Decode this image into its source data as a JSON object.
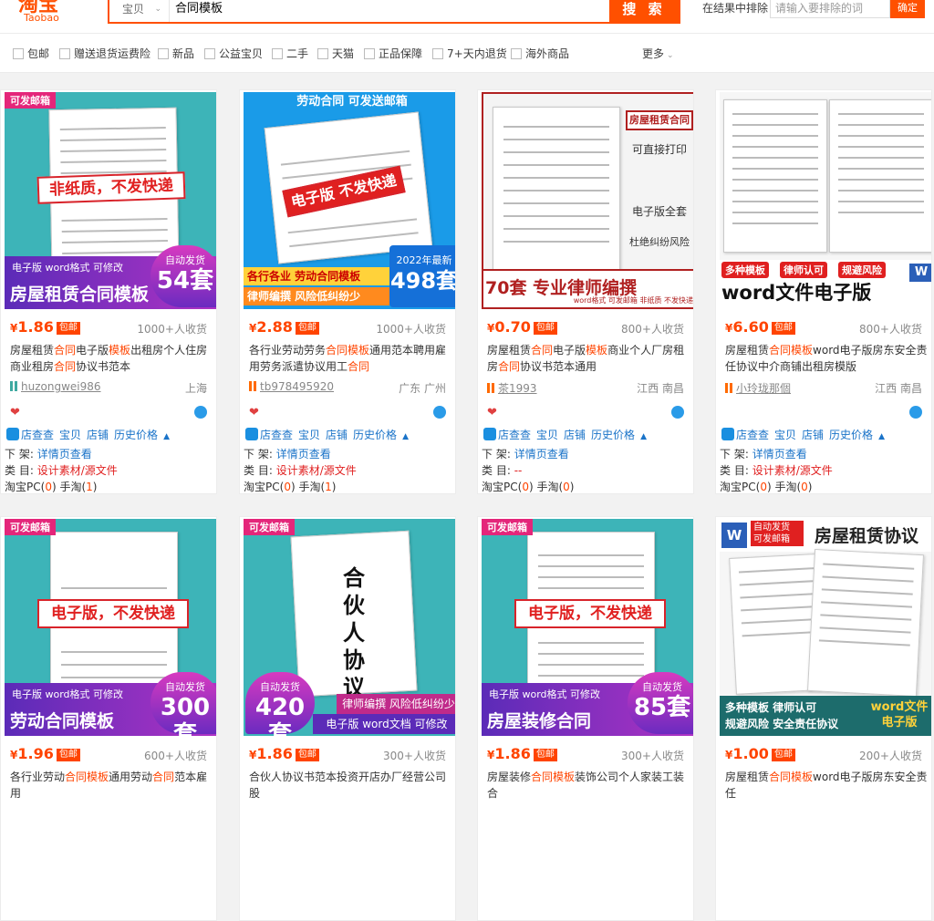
{
  "header": {
    "logo_cn": "淘宝",
    "logo_en": "Taobao",
    "search_category": "宝贝",
    "search_query": "合同模板",
    "search_button": "搜 索",
    "exclude_label": "在结果中排除",
    "exclude_placeholder": "请输入要排除的词",
    "exclude_button": "确定"
  },
  "filters": [
    "包邮",
    "赠送退货运费险",
    "新品",
    "公益宝贝",
    "二手",
    "天猫",
    "正品保障",
    "7+天内退货",
    "海外商品"
  ],
  "more_label": "更多",
  "products": [
    {
      "tag": "可发邮箱",
      "img_band": "非纸质，不发快递",
      "img_small": "电子版 word格式 可修改",
      "img_big": "房屋租赁合同模板",
      "img_badge_small": "自动发货",
      "img_badge_num": "54套",
      "price": "1.86",
      "post": "包邮",
      "sold": "1000+人收货",
      "title": "房屋租赁合同电子版模板出租房个人住房商业租房合同协议书范本",
      "shop": "huzongwei986",
      "loc": "上海",
      "tools": [
        "店查查",
        "宝贝",
        "店铺",
        "历史价格"
      ],
      "xiajia": "详情页查看",
      "cat": "设计素材/源文件",
      "pc": "0",
      "sj": "1"
    },
    {
      "tag": "劳动合同 可发送邮箱",
      "img_band": "电子版 不发快递",
      "img_small": "各行各业 劳动合同模板",
      "img_big": "律师编撰 风险低纠纷少",
      "img_badge_small": "2022年最新",
      "img_badge_num": "498套",
      "price": "2.88",
      "post": "包邮",
      "sold": "1000+人收货",
      "title": "各行业劳动劳务合同模板通用范本聘用雇用劳务派遣协议用工合同",
      "shop": "tb978495920",
      "loc": "广东 广州",
      "tools": [
        "店查查",
        "宝贝",
        "店铺",
        "历史价格"
      ],
      "xiajia": "详情页查看",
      "cat": "设计素材/源文件",
      "pc": "0",
      "sj": "1"
    },
    {
      "tag": "房屋租赁合同",
      "img_band": "70套 专业律师编撰",
      "img_small": "可直接打印",
      "img_big": "word格式 可发邮箱 非纸质 不发快递",
      "img_badge_small": "电子版全套",
      "img_badge_num": "杜绝纠纷风险",
      "price": "0.70",
      "post": "包邮",
      "sold": "800+人收货",
      "title": "房屋租赁合同电子版模板商业个人厂房租房合同协议书范本通用",
      "shop": "茶1993",
      "loc": "江西 南昌",
      "tools": [
        "店查查",
        "宝贝",
        "店铺",
        "历史价格"
      ],
      "xiajia": "详情页查看",
      "cat": "--",
      "pc": "0",
      "sj": "0"
    },
    {
      "tag": "多种模板",
      "img_band": "律师认可",
      "img_small": "规避风险",
      "img_big": "word文件电子版",
      "img_badge_small": "",
      "img_badge_num": "",
      "price": "6.60",
      "post": "包邮",
      "sold": "800+人收货",
      "title": "房屋租赁合同模板word电子版房东安全责任协议中介商铺出租房模版",
      "shop": "小玲珑那個",
      "loc": "江西 南昌",
      "tools": [
        "店查查",
        "宝贝",
        "店铺",
        "历史价格"
      ],
      "xiajia": "详情页查看",
      "cat": "设计素材/源文件",
      "pc": "0",
      "sj": "0"
    },
    {
      "tag": "可发邮箱",
      "img_band": "电子版，不发快递",
      "img_small": "电子版 word格式 可修改",
      "img_big": "劳动合同模板",
      "img_badge_small": "自动发货",
      "img_badge_num": "300套",
      "price": "1.96",
      "post": "包邮",
      "sold": "600+人收货",
      "title": "各行业劳动合同模板通用劳动合同范本雇用",
      "shop": "",
      "loc": "",
      "tools": [],
      "xiajia": "",
      "cat": "",
      "pc": "",
      "sj": ""
    },
    {
      "tag": "可发邮箱",
      "img_band": "合伙人协议",
      "img_small": "律师编撰 风险低纠纷少",
      "img_big": "电子版 word文档 可修改",
      "img_badge_small": "自动发货",
      "img_badge_num": "420套",
      "price": "1.86",
      "post": "包邮",
      "sold": "300+人收货",
      "title": "合伙人协议书范本投资开店办厂经营公司股",
      "shop": "",
      "loc": "",
      "tools": [],
      "xiajia": "",
      "cat": "",
      "pc": "",
      "sj": ""
    },
    {
      "tag": "可发邮箱",
      "img_band": "电子版，不发快递",
      "img_small": "电子版 word格式 可修改",
      "img_big": "房屋装修合同",
      "img_badge_small": "自动发货",
      "img_badge_num": "85套",
      "price": "1.86",
      "post": "包邮",
      "sold": "300+人收货",
      "title": "房屋装修合同模板装饰公司个人家装工装合",
      "shop": "",
      "loc": "",
      "tools": [],
      "xiajia": "",
      "cat": "",
      "pc": "",
      "sj": ""
    },
    {
      "tag": "自动发货 可发邮箱",
      "img_band": "房屋租赁协议",
      "img_small": "多种模板 律师认可",
      "img_big": "规避风险 安全责任协议",
      "img_badge_small": "word文件",
      "img_badge_num": "电子版",
      "price": "1.00",
      "post": "包邮",
      "sold": "200+人收货",
      "title": "房屋租赁合同模板word电子版房东安全责任",
      "shop": "",
      "loc": "",
      "tools": [],
      "xiajia": "",
      "cat": "",
      "pc": "",
      "sj": ""
    }
  ],
  "labels": {
    "currency": "¥",
    "xiajia_label": "下 架:",
    "cat_label": "类 目:",
    "pc_label": "淘宝PC(",
    "sj_label": "手淘(",
    "close": ")"
  }
}
